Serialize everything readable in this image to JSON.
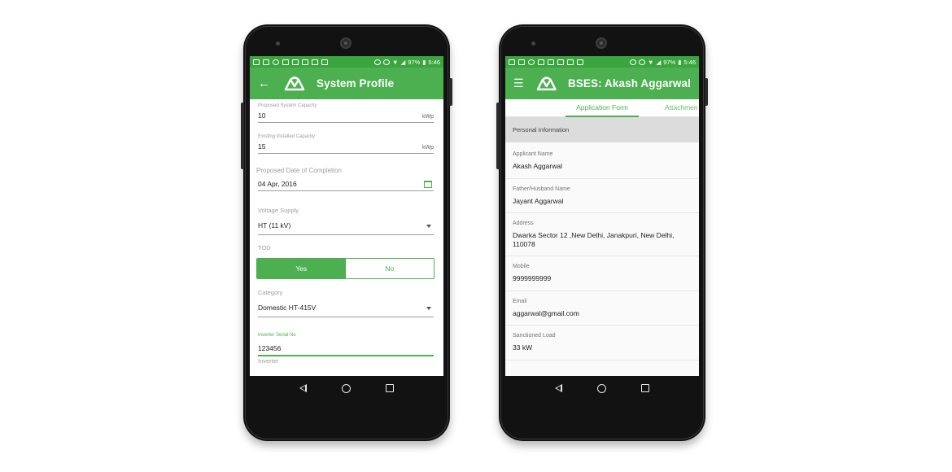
{
  "colors": {
    "primary": "#4caf50",
    "status_bar": "#3aa53f",
    "accent_text": "#4caf50"
  },
  "status_bar": {
    "battery": "97%",
    "time": "5:46"
  },
  "left_phone": {
    "appbar": {
      "nav_icon": "back-arrow-icon",
      "title": "System Profile"
    },
    "fields": {
      "proposed_capacity": {
        "label": "Proposed System Capacity",
        "value": "10",
        "unit": "kWp"
      },
      "existing_capacity": {
        "label": "Existing Installed Capacity",
        "value": "15",
        "unit": "kWp"
      },
      "completion_date": {
        "label": "Proposed Date of Completion",
        "value": "04 Apr, 2016"
      },
      "voltage_supply": {
        "label": "Voltage Supply",
        "value": "HT (11 kV)"
      },
      "tod": {
        "label": "TOD",
        "options": [
          "Yes",
          "No"
        ],
        "selected": "Yes"
      },
      "category": {
        "label": "Category",
        "value": "Domestic HT-415V"
      },
      "inverter_serial": {
        "label": "Inverter Serial No",
        "value": "123456"
      },
      "inverter": {
        "label": "Inverter"
      }
    }
  },
  "right_phone": {
    "appbar": {
      "nav_icon": "menu-icon",
      "title": "BSES: Akash Aggarwal"
    },
    "tabs": [
      {
        "label": "Application Form",
        "active": true
      },
      {
        "label": "Attachmen",
        "active": false
      }
    ],
    "section_title": "Personal Information",
    "items": [
      {
        "label": "Applicant Name",
        "value": "Akash Aggarwal"
      },
      {
        "label": "Father/Husband Name",
        "value": "Jayant Aggarwal"
      },
      {
        "label": "Address",
        "value": "Dwarka Sector 12 ,New Delhi, Janakpuri, New Delhi, 110078"
      },
      {
        "label": "Mobile",
        "value": "9999999999"
      },
      {
        "label": "Email",
        "value": "aggarwal@gmail.com"
      },
      {
        "label": "Sanctioned Load",
        "value": "33 kW"
      }
    ]
  }
}
